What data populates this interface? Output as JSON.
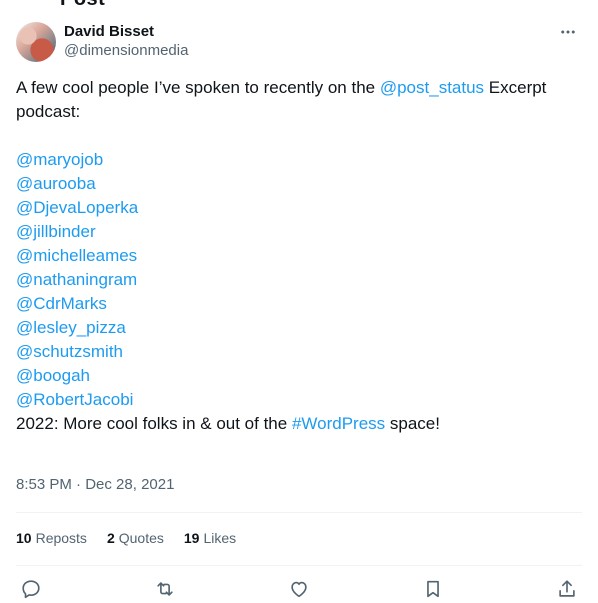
{
  "top_cut_text": "Post",
  "author": {
    "display_name": "David Bisset",
    "handle": "@dimensionmedia"
  },
  "tweet": {
    "text_before": "A few cool people I’ve spoken to recently on the ",
    "link_mention": "@post_status",
    "text_after": " Excerpt podcast:",
    "mentions": [
      "@maryojob",
      "@aurooba",
      "@DjevaLoperka",
      "@jillbinder",
      "@michelleames",
      "@nathaningram",
      "@CdrMarks",
      "@lesley_pizza",
      "@schutzsmith",
      "@boogah",
      "@RobertJacobi"
    ],
    "closing_before": "2022: More cool folks in & out of the ",
    "hashtag": "#WordPress",
    "closing_after": " space!"
  },
  "meta": {
    "time": "8:53 PM",
    "separator": " · ",
    "date": "Dec 28, 2021"
  },
  "stats": {
    "reposts_count": "10",
    "reposts_label": "Reposts",
    "quotes_count": "2",
    "quotes_label": "Quotes",
    "likes_count": "19",
    "likes_label": "Likes"
  },
  "icons": {
    "more": "more-icon",
    "reply": "reply-icon",
    "repost": "repost-icon",
    "like": "like-icon",
    "bookmark": "bookmark-icon",
    "share": "share-icon"
  },
  "colors": {
    "link": "#1d9bf0",
    "text": "#0f1419",
    "secondary": "#536471",
    "divider": "#eff3f4"
  }
}
